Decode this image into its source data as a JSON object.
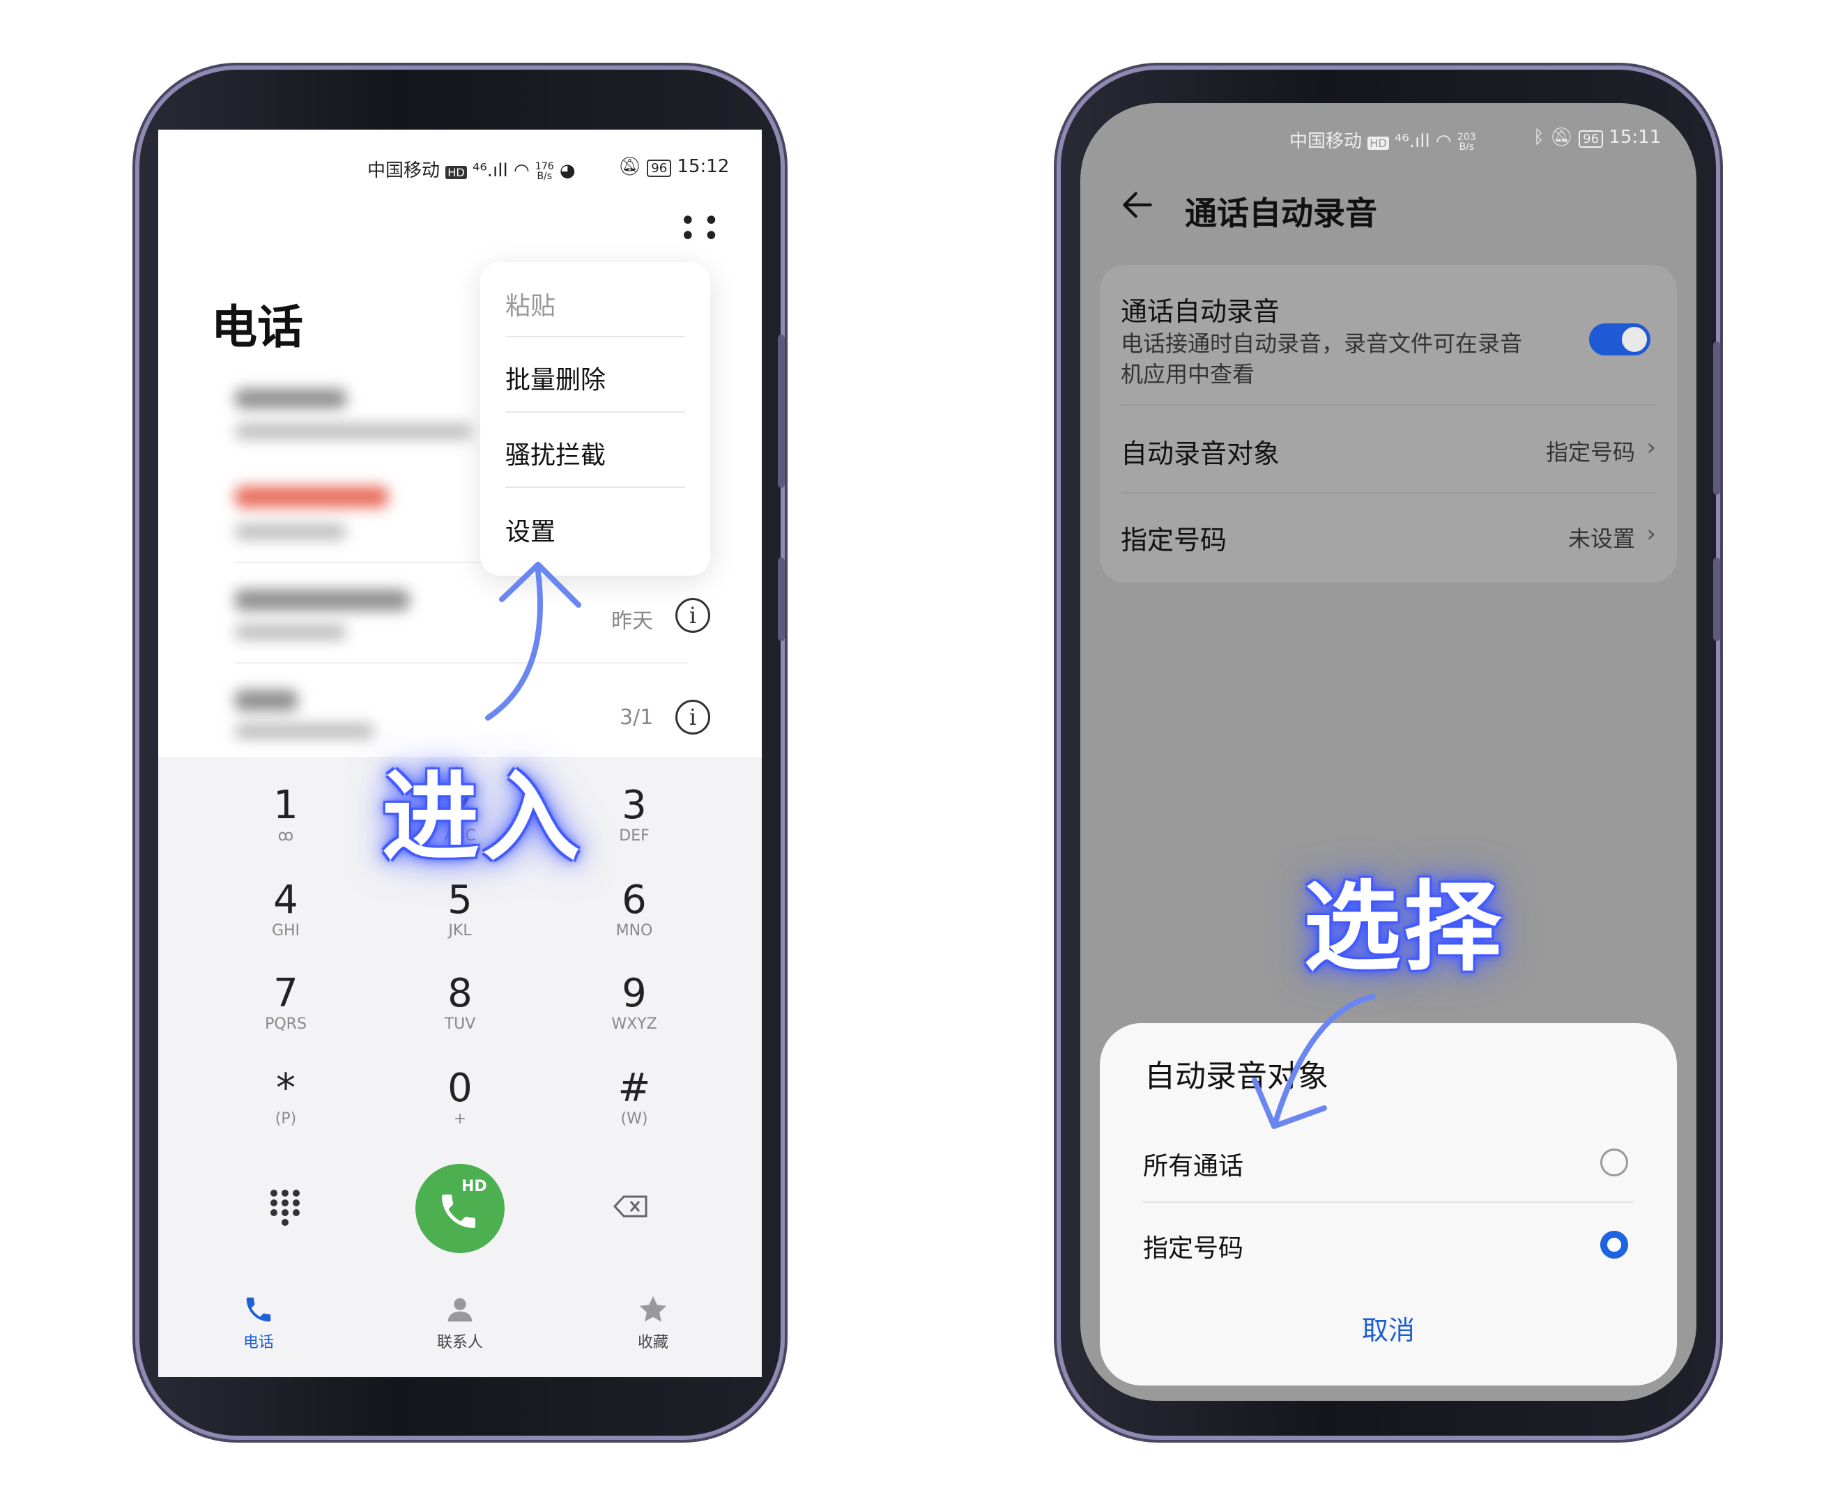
{
  "left": {
    "status": {
      "carrier": "中国移动",
      "hd": "HD",
      "net": "⁴⁶.ıll",
      "speed_num": "176",
      "speed_unit": "B/s",
      "battery": "96",
      "time": "15:12"
    },
    "page_title": "电话",
    "menu": {
      "items": [
        "粘贴",
        "批量删除",
        "骚扰拦截",
        "设置"
      ]
    },
    "calls": [
      {
        "date": "昨天"
      },
      {
        "date": "3/1"
      }
    ],
    "keypad": [
      {
        "digit": "1",
        "letters": "ꝏ"
      },
      {
        "digit": "2",
        "letters": "ABC"
      },
      {
        "digit": "3",
        "letters": "DEF"
      },
      {
        "digit": "4",
        "letters": "GHI"
      },
      {
        "digit": "5",
        "letters": "JKL"
      },
      {
        "digit": "6",
        "letters": "MNO"
      },
      {
        "digit": "7",
        "letters": "PQRS"
      },
      {
        "digit": "8",
        "letters": "TUV"
      },
      {
        "digit": "9",
        "letters": "WXYZ"
      },
      {
        "digit": "*",
        "letters": "(P)"
      },
      {
        "digit": "0",
        "letters": "+"
      },
      {
        "digit": "#",
        "letters": "(W)"
      }
    ],
    "call_button_badge": "HD",
    "bottom_nav": [
      {
        "label": "电话",
        "icon": "phone-icon"
      },
      {
        "label": "联系人",
        "icon": "contacts-icon"
      },
      {
        "label": "收藏",
        "icon": "star-icon"
      }
    ],
    "overlay": "进入"
  },
  "right": {
    "status": {
      "carrier": "中国移动",
      "hd": "HD",
      "net": "⁴⁶.ıll",
      "speed_num": "203",
      "speed_unit": "B/s",
      "battery": "96",
      "time": "15:11"
    },
    "header_title": "通话自动录音",
    "setting_toggle": {
      "title": "通话自动录音",
      "desc_line1": "电话接通时自动录音，录音文件可在录音",
      "desc_line2": "机应用中查看",
      "enabled": true
    },
    "setting_target": {
      "title": "自动录音对象",
      "value": "指定号码"
    },
    "setting_numbers": {
      "title": "指定号码",
      "value": "未设置"
    },
    "sheet": {
      "title": "自动录音对象",
      "options": [
        {
          "label": "所有通话",
          "selected": false
        },
        {
          "label": "指定号码",
          "selected": true
        }
      ],
      "cancel": "取消"
    },
    "overlay": "选择"
  }
}
